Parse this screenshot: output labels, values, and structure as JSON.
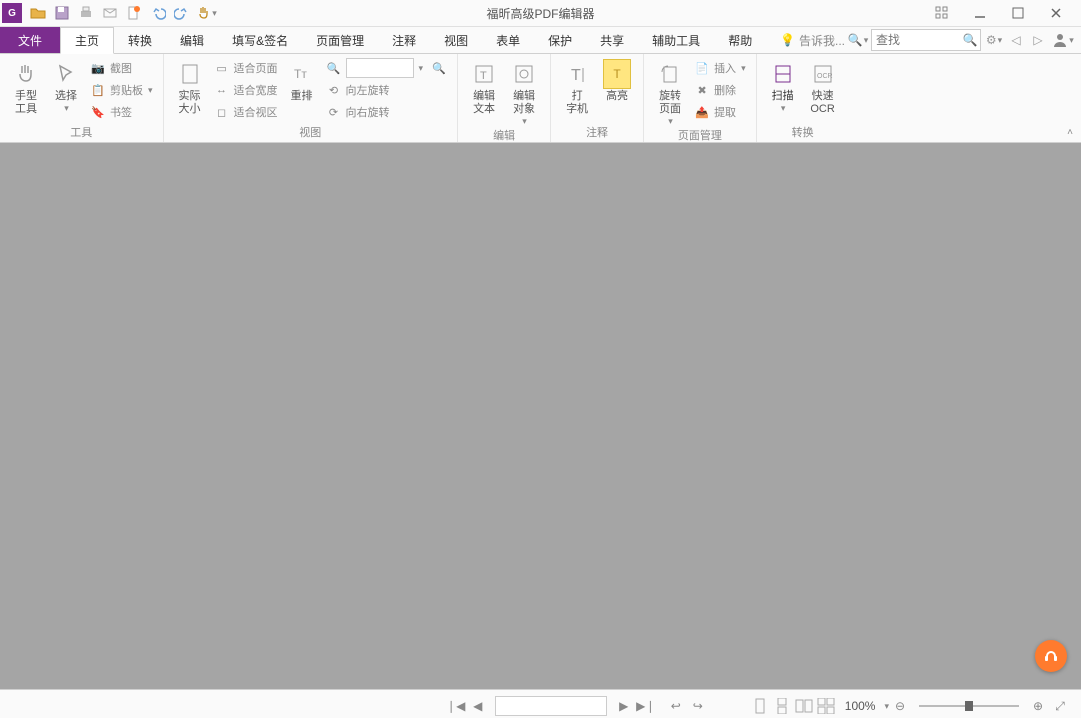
{
  "app": {
    "title": "福昕高级PDF编辑器"
  },
  "tabs": {
    "file": "文件",
    "items": [
      "主页",
      "转换",
      "编辑",
      "填写&签名",
      "页面管理",
      "注释",
      "视图",
      "表单",
      "保护",
      "共享",
      "辅助工具",
      "帮助"
    ],
    "tellme": "告诉我...",
    "search_placeholder": "查找"
  },
  "ribbon": {
    "tools": {
      "label": "工具",
      "hand": "手型\n工具",
      "select": "选择",
      "screenshot": "截图",
      "clipboard": "剪贴板",
      "bookmark": "书签"
    },
    "view": {
      "label": "视图",
      "actual": "实际\n大小",
      "reflow": "重排",
      "fitpage": "适合页面",
      "fitwidth": "适合宽度",
      "fitvisible": "适合视区",
      "rotleft": "向左旋转",
      "rotright": "向右旋转"
    },
    "edit": {
      "label": "编辑",
      "text": "编辑\n文本",
      "object": "编辑\n对象"
    },
    "annot": {
      "label": "注释",
      "type": "打\n字机",
      "highlight": "高亮"
    },
    "pagemgr": {
      "label": "页面管理",
      "rotate": "旋转\n页面",
      "insert": "插入",
      "delete": "删除",
      "extract": "提取"
    },
    "convert": {
      "label": "转换",
      "scan": "扫描",
      "ocr": "快速\nOCR"
    }
  },
  "status": {
    "zoom": "100%"
  }
}
